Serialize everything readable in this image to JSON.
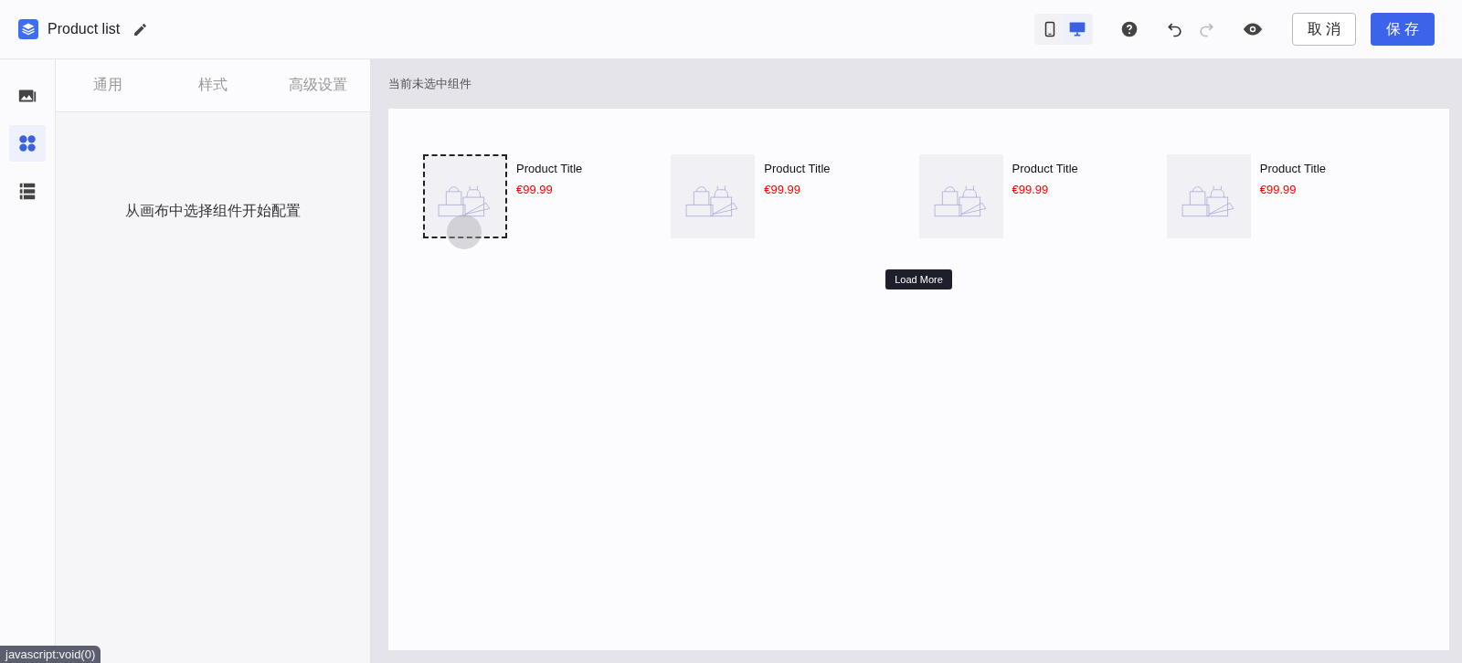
{
  "header": {
    "title": "Product list",
    "devices": [
      {
        "kind": "mobile",
        "selected": false
      },
      {
        "kind": "desktop",
        "selected": true
      }
    ],
    "cancel": "取 消",
    "save": "保 存"
  },
  "rail": [
    {
      "kind": "images",
      "selected": false
    },
    {
      "kind": "components",
      "selected": true
    },
    {
      "kind": "layers",
      "selected": false
    }
  ],
  "panel": {
    "tabs": [
      {
        "label": "通用",
        "selected": false
      },
      {
        "label": "样式",
        "selected": false
      },
      {
        "label": "高级设置",
        "selected": false
      }
    ],
    "empty_message": "从画布中选择组件开始配置"
  },
  "canvas": {
    "status": "当前未选中组件",
    "products": [
      {
        "title": "Product Title",
        "price": "€99.99",
        "selected": true
      },
      {
        "title": "Product Title",
        "price": "€99.99",
        "selected": false
      },
      {
        "title": "Product Title",
        "price": "€99.99",
        "selected": false
      },
      {
        "title": "Product Title",
        "price": "€99.99",
        "selected": false
      }
    ],
    "load_more": "Load More"
  },
  "status_bar": "javascript:void(0)"
}
